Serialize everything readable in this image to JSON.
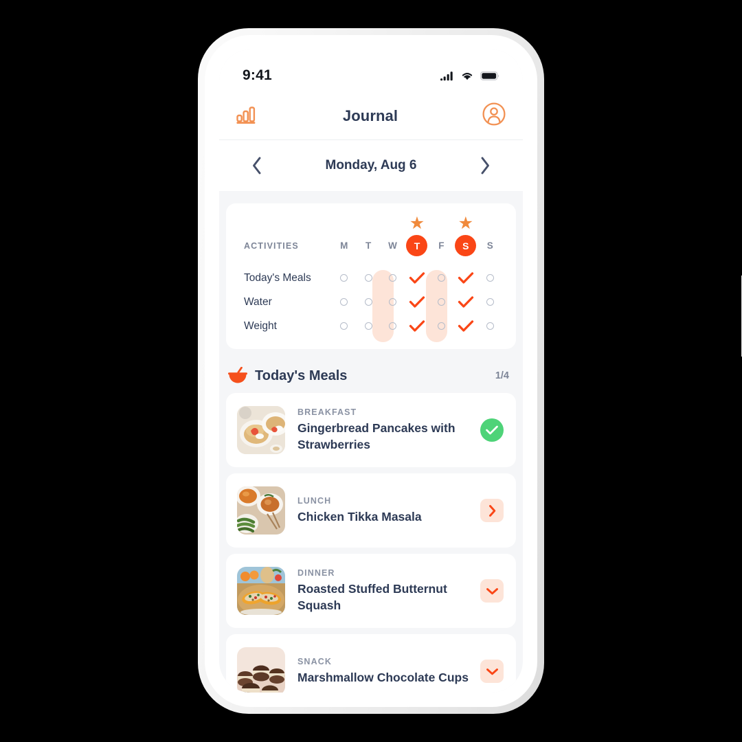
{
  "status_bar": {
    "time": "9:41",
    "icons": [
      "signal-icon",
      "wifi-icon",
      "battery-icon"
    ]
  },
  "header": {
    "title": "Journal",
    "left_icon": "bar-chart-icon",
    "right_icon": "profile-avatar-icon"
  },
  "date_nav": {
    "prev_icon": "chevron-left-icon",
    "next_icon": "chevron-right-icon",
    "date_label": "Monday, Aug 6"
  },
  "activities": {
    "header_label": "ACTIVITIES",
    "days": [
      {
        "letter": "M",
        "active": false,
        "star": false
      },
      {
        "letter": "T",
        "active": false,
        "star": false
      },
      {
        "letter": "W",
        "active": false,
        "star": false
      },
      {
        "letter": "T",
        "active": true,
        "star": true
      },
      {
        "letter": "F",
        "active": false,
        "star": false
      },
      {
        "letter": "S",
        "active": true,
        "star": true
      },
      {
        "letter": "S",
        "active": false,
        "star": false
      }
    ],
    "rows": [
      {
        "label": "Today's Meals",
        "checks": [
          false,
          false,
          false,
          true,
          false,
          true,
          false
        ]
      },
      {
        "label": "Water",
        "checks": [
          false,
          false,
          false,
          true,
          false,
          true,
          false
        ]
      },
      {
        "label": "Weight",
        "checks": [
          false,
          false,
          false,
          true,
          false,
          true,
          false
        ]
      }
    ]
  },
  "meals_section": {
    "icon": "bowl-icon",
    "title": "Today's Meals",
    "count": "1/4"
  },
  "meals": [
    {
      "type": "BREAKFAST",
      "name": "Gingerbread Pancakes with Strawberries",
      "thumb": "pancakes-strawberries-photo",
      "action": "completed-check",
      "action_icon": "check-icon"
    },
    {
      "type": "LUNCH",
      "name": "Chicken Tikka Masala",
      "thumb": "curry-green-beans-photo",
      "action": "expand-right",
      "action_icon": "chevron-right-icon"
    },
    {
      "type": "DINNER",
      "name": "Roasted Stuffed Butternut Squash",
      "thumb": "butternut-squash-photo",
      "action": "expand-down",
      "action_icon": "chevron-down-icon"
    },
    {
      "type": "SNACK",
      "name": "Marshmallow Chocolate Cups",
      "thumb": "chocolate-cups-photo",
      "action": "expand-down",
      "action_icon": "chevron-down-icon"
    }
  ],
  "colors": {
    "accent_orange": "#fa4616",
    "accent_light_orange": "#f08a3c",
    "accent_pale": "#fde4d8",
    "text_dark": "#2d3a55",
    "text_muted": "#7d8597",
    "success_green": "#4ed378",
    "screen_bg": "#f5f6f8"
  }
}
